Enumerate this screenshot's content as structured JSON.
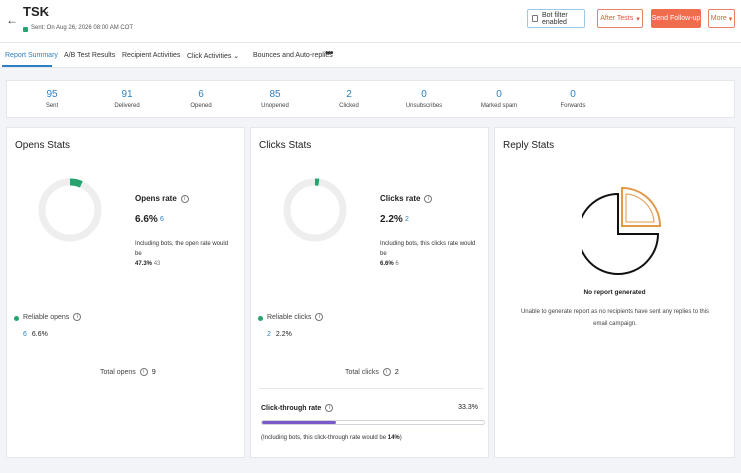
{
  "header": {
    "back_glyph": "←",
    "title": "TSK",
    "title_caret": "⌄",
    "sent_text": "Sent: On Aug 26, 2026 08:00 AM COT",
    "bot_filter_label": "Bot filter enabled",
    "after_tests_label": "After Tests",
    "send_followup_label": "Send Follow-up",
    "more_label": "More",
    "caret": "▾",
    "accent_color": "#ef6c4d"
  },
  "tabs": [
    {
      "label": "Report Summary",
      "active": true
    },
    {
      "label": "A/B Test Results"
    },
    {
      "label": "Recipient Activities"
    },
    {
      "label": "Click Activities ⌄"
    },
    {
      "label": "Bounces and Auto-replies"
    }
  ],
  "tabs_more": "•••",
  "summary": [
    {
      "value": "95",
      "label": "Sent"
    },
    {
      "value": "91",
      "label": "Delivered"
    },
    {
      "value": "6",
      "label": "Opened"
    },
    {
      "value": "85",
      "label": "Unopened"
    },
    {
      "value": "2",
      "label": "Clicked"
    },
    {
      "value": "0",
      "label": "Unsubscribes"
    },
    {
      "value": "0",
      "label": "Marked spam"
    },
    {
      "value": "0",
      "label": "Forwards"
    }
  ],
  "info_glyph": "i",
  "opens": {
    "title": "Opens Stats",
    "rate_label": "Opens rate",
    "rate_pct": "6.6%",
    "rate_count": "6",
    "rate_fraction": 0.066,
    "note_text": "Including bots, the open rate would be",
    "note_pct": "47.3%",
    "note_count": "43",
    "reliable_label": "Reliable opens",
    "reliable_count": "6",
    "reliable_pct": "6.6%",
    "total_label": "Total opens",
    "total_value": "9"
  },
  "clicks": {
    "title": "Clicks Stats",
    "rate_label": "Clicks rate",
    "rate_pct": "2.2%",
    "rate_count": "2",
    "rate_fraction": 0.022,
    "note_text": "Including bots, this clicks rate would be",
    "note_pct": "6.6%",
    "note_count": "6",
    "reliable_label": "Reliable clicks",
    "reliable_count": "2",
    "reliable_pct": "2.2%",
    "total_label": "Total clicks",
    "total_value": "2",
    "ctr_label": "Click-through rate",
    "ctr_value": "33.3%",
    "ctr_fraction": 0.333,
    "ctr_note_pre": "(Including bots, this click-through rate would be",
    "ctr_note_pct": "14%",
    "ctr_note_post": ")"
  },
  "reply": {
    "title": "Reply Stats",
    "no_report": "No report generated",
    "message": "Unable to generate report as no recipients have sent any replies to this email campaign."
  },
  "colors": {
    "primary": "#2f80c2",
    "success": "#27a36f",
    "ctr_bar": "#7a59c9",
    "track": "#eeeeee"
  }
}
